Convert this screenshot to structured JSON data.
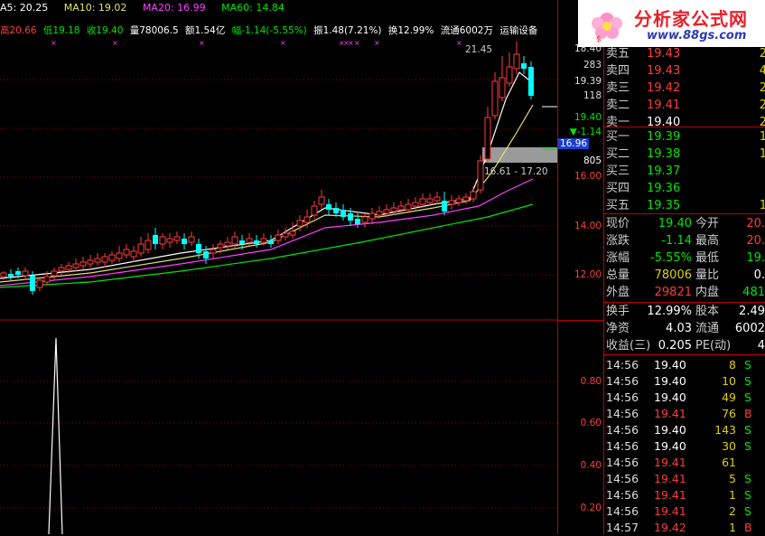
{
  "colors": {
    "up": "#ff3c3c",
    "down": "#00e600",
    "candle_up": "#ff3c3c",
    "candle_down": "#00ffff",
    "ma5": "#ffffff",
    "ma10": "#e0e070",
    "ma20": "#ff40ff",
    "ma60": "#00e600"
  },
  "ma_bar": {
    "ma5": "A5: 20.25",
    "ma10": "MA10: 19.02",
    "ma20": "MA20: 16.99",
    "ma60": "MA60: 14.84"
  },
  "stats_bar": {
    "high": "高20.66",
    "low": "低19.18",
    "close": "收19.40",
    "volume": "量78006.5",
    "amount": "额1.54亿",
    "change": "幅-1.14(-5.55%)",
    "amplitude": "振1.48(7.21%)",
    "turnover": "换12.99%",
    "float": "流通6002万",
    "sector": "运输设备"
  },
  "chart_annotations": {
    "high_label": "21.45",
    "range_label": "16.61 - 17.20",
    "crosshair_price": "16.96"
  },
  "price_axis": [
    "18.40",
    "283",
    "19.39",
    "118",
    "19.40",
    "▼-1.14",
    "805",
    "16.00",
    "14.00",
    "12.00"
  ],
  "indicator_axis": [
    "0.80",
    "0.60",
    "0.40",
    "0.20"
  ],
  "logo": {
    "title": "分析家公式网",
    "url": "www.88gs.com"
  },
  "asks": [
    {
      "label": "卖五",
      "price": "19.43",
      "vol": "2"
    },
    {
      "label": "卖四",
      "price": "19.43",
      "vol": "4"
    },
    {
      "label": "卖三",
      "price": "19.42",
      "vol": "2"
    },
    {
      "label": "卖二",
      "price": "19.41",
      "vol": "2"
    },
    {
      "label": "卖一",
      "price": "19.40",
      "vol": "2"
    }
  ],
  "bids": [
    {
      "label": "买一",
      "price": "19.39",
      "vol": "1"
    },
    {
      "label": "买二",
      "price": "19.38",
      "vol": "1"
    },
    {
      "label": "买三",
      "price": "19.37",
      "vol": ""
    },
    {
      "label": "买四",
      "price": "19.36",
      "vol": ""
    },
    {
      "label": "买五",
      "price": "19.35",
      "vol": "1"
    }
  ],
  "quote": [
    {
      "l1": "现价",
      "v1": "19.40",
      "l2": "今开",
      "v2": "20."
    },
    {
      "l1": "涨跌",
      "v1": "-1.14",
      "l2": "最高",
      "v2": "20."
    },
    {
      "l1": "涨幅",
      "v1": "-5.55%",
      "l2": "最低",
      "v2": "19."
    },
    {
      "l1": "总量",
      "v1": "78006",
      "l2": "量比",
      "v2": "0."
    },
    {
      "l1": "外盘",
      "v1": "29821",
      "l2": "内盘",
      "v2": "481"
    }
  ],
  "fundamentals": [
    {
      "l1": "换手",
      "v1": "12.99%",
      "l2": "股本",
      "v2": "2.49"
    },
    {
      "l1": "净资",
      "v1": "4.03",
      "l2": "流通",
      "v2": "6002"
    },
    {
      "l1": "收益(三)",
      "v1": "0.205",
      "l2": "PE(动)",
      "v2": "4"
    }
  ],
  "ticks": [
    {
      "time": "14:56",
      "price": "19.40",
      "vol": "8",
      "side": "S"
    },
    {
      "time": "14:56",
      "price": "19.40",
      "vol": "10",
      "side": "S"
    },
    {
      "time": "14:56",
      "price": "19.40",
      "vol": "49",
      "side": "S"
    },
    {
      "time": "14:56",
      "price": "19.41",
      "vol": "76",
      "side": "B"
    },
    {
      "time": "14:56",
      "price": "19.40",
      "vol": "143",
      "side": "S"
    },
    {
      "time": "14:56",
      "price": "19.40",
      "vol": "30",
      "side": "S"
    },
    {
      "time": "14:56",
      "price": "19.41",
      "vol": "61",
      "side": ""
    },
    {
      "time": "14:56",
      "price": "19.41",
      "vol": "5",
      "side": "S"
    },
    {
      "time": "14:56",
      "price": "19.41",
      "vol": "1",
      "side": "S"
    },
    {
      "time": "14:56",
      "price": "19.41",
      "vol": "2",
      "side": "S"
    },
    {
      "time": "14:57",
      "price": "19.42",
      "vol": "1",
      "side": "B"
    }
  ]
}
